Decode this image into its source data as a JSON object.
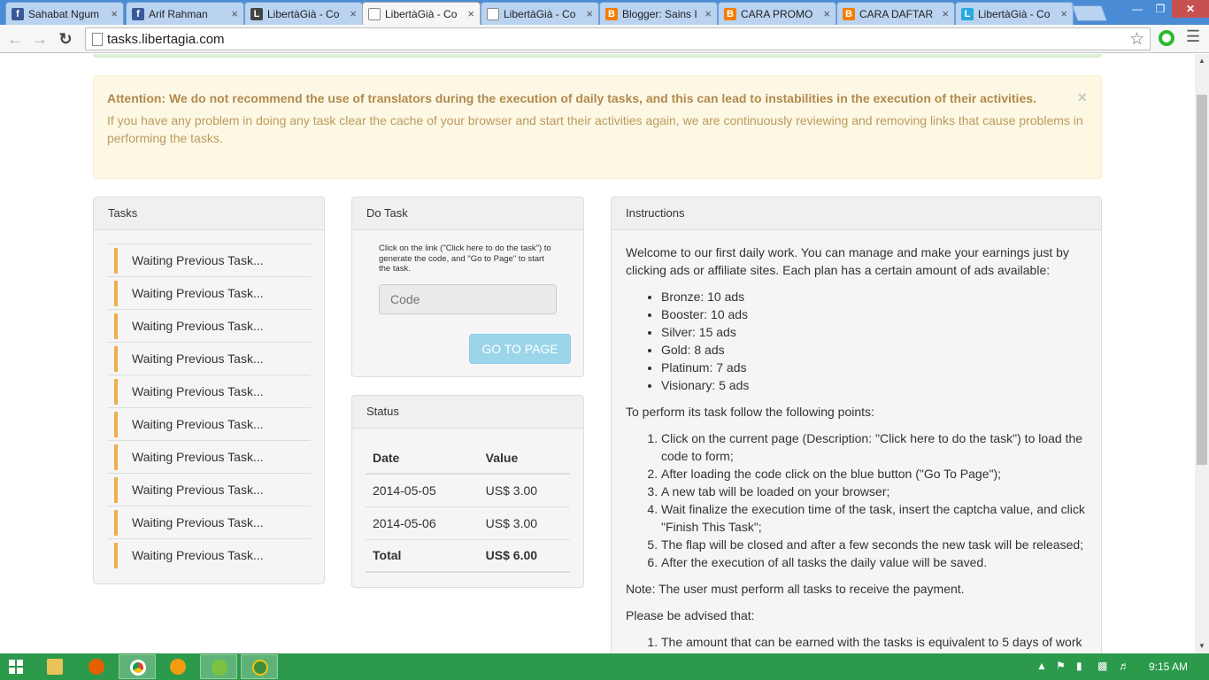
{
  "browser": {
    "tabs": [
      {
        "title": "Sahabat Ngum",
        "favicon": "facebook-icon",
        "active": false
      },
      {
        "title": "Arif Rahman",
        "favicon": "facebook-icon",
        "active": false
      },
      {
        "title": "LibertàGià - Co",
        "favicon": "libertagia-icon",
        "active": false
      },
      {
        "title": "LibertàGià - Co",
        "favicon": "document-icon",
        "active": true
      },
      {
        "title": "LibertàGià - Co",
        "favicon": "document-icon",
        "active": false
      },
      {
        "title": "Blogger: Sains I",
        "favicon": "blogger-icon",
        "active": false
      },
      {
        "title": "CARA PROMO",
        "favicon": "blogger-icon",
        "active": false
      },
      {
        "title": "CARA DAFTAR",
        "favicon": "blogger-icon",
        "active": false
      },
      {
        "title": "LibertàGià - Co",
        "favicon": "libertagia-blue-icon",
        "active": false
      }
    ],
    "url": "tasks.libertagia.com"
  },
  "alert": {
    "strong": "Attention: We do not recommend the use of translators during the execution of daily tasks, and this can lead to instabilities in the execution of their activities.",
    "body": "If you have any problem in doing any task clear the cache of your browser and start their activities again, we are continuously reviewing and removing links that cause problems in performing the tasks.",
    "close": "×"
  },
  "tasks": {
    "heading": "Tasks",
    "items": [
      "Waiting Previous Task...",
      "Waiting Previous Task...",
      "Waiting Previous Task...",
      "Waiting Previous Task...",
      "Waiting Previous Task...",
      "Waiting Previous Task...",
      "Waiting Previous Task...",
      "Waiting Previous Task...",
      "Waiting Previous Task...",
      "Waiting Previous Task..."
    ]
  },
  "do_task": {
    "heading": "Do Task",
    "hint": "Click on the link (\"Click here to do the task\") to generate the code, and \"Go to Page\" to start the task.",
    "code_placeholder": "Code",
    "button": "GO TO PAGE"
  },
  "status": {
    "heading": "Status",
    "columns": [
      "Date",
      "Value"
    ],
    "rows": [
      [
        "2014-05-05",
        "US$ 3.00"
      ],
      [
        "2014-05-06",
        "US$ 3.00"
      ]
    ],
    "total": [
      "Total",
      "US$ 6.00"
    ]
  },
  "instructions": {
    "heading": "Instructions",
    "intro": "Welcome to our first daily work. You can manage and make your earnings just by clicking ads or affiliate sites. Each plan has a certain amount of ads available:",
    "plans": [
      "Bronze: 10 ads",
      "Booster: 10 ads",
      "Silver: 15 ads",
      "Gold: 8 ads",
      "Platinum: 7 ads",
      "Visionary: 5 ads"
    ],
    "steps_intro": "To perform its task follow the following points:",
    "steps": [
      "Click on the current page (Description: \"Click here to do the task\") to load the code to form;",
      "After loading the code click on the blue button (\"Go To Page\");",
      "A new tab will be loaded on your browser;",
      "Wait finalize the execution time of the task, insert the captcha value, and click \"Finish This Task\";",
      "The flap will be closed and after a few seconds the new task will be released;",
      "After the execution of all tasks the daily value will be saved."
    ],
    "note": "Note: The user must perform all tasks to receive the payment.",
    "advise": "Please be advised that:",
    "advise_items": [
      "The amount that can be earned with the tasks is equivalent to 5 days of work"
    ]
  },
  "taskbar": {
    "clock": "9:15 AM",
    "accent": "#2b9a4b"
  }
}
